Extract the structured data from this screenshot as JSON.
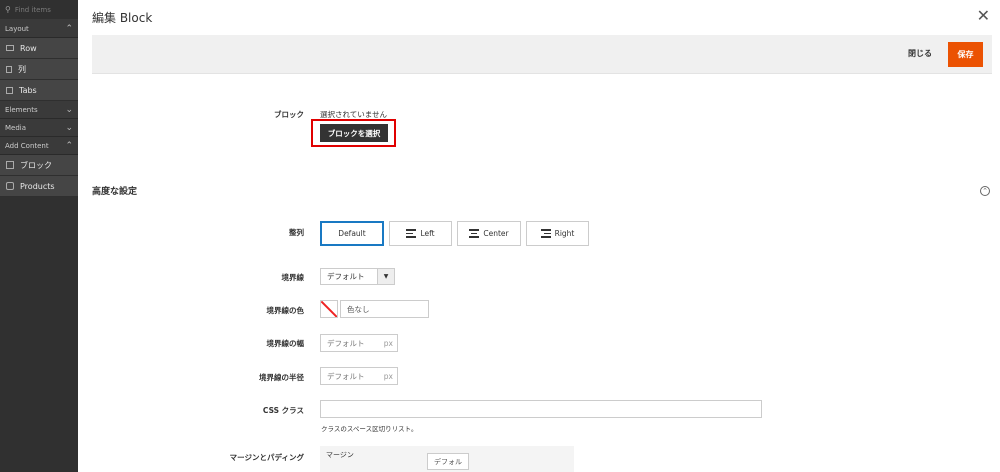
{
  "sidebar": {
    "search_placeholder": "Find items",
    "sections": {
      "layout": "Layout",
      "elements": "Elements",
      "media": "Media",
      "add_content": "Add Content"
    },
    "layout_items": [
      {
        "label": "Row",
        "icon": "row-icon"
      },
      {
        "label": "列",
        "icon": "column-icon"
      },
      {
        "label": "Tabs",
        "icon": "tabs-icon"
      }
    ],
    "add_content_items": [
      {
        "label": "ブロック",
        "icon": "block-icon"
      },
      {
        "label": "Products",
        "icon": "products-icon"
      }
    ]
  },
  "header": {
    "title": "編集 Block",
    "close_label": "閉じる",
    "save_label": "保存"
  },
  "block": {
    "label": "ブロック",
    "value": "選択されていません",
    "select_button": "ブロックを選択"
  },
  "advanced": {
    "title": "高度な設定",
    "alignment_label": "整列",
    "alignment_options": [
      "Default",
      "Left",
      "Center",
      "Right"
    ],
    "border_label": "境界線",
    "border_value": "デフォルト",
    "border_color_label": "境界線の色",
    "border_color_placeholder": "色なし",
    "border_width_label": "境界線の幅",
    "border_width_placeholder": "デフォルト",
    "border_width_unit": "px",
    "border_radius_label": "境界線の半径",
    "border_radius_placeholder": "デフォルト",
    "border_radius_unit": "px",
    "css_label": "CSS クラス",
    "css_hint": "クラスのスペース区切りリスト。",
    "margin_padding_label": "マージンとパディング",
    "margin_label": "マージン",
    "margin_value": "デフォル"
  },
  "colors": {
    "accent": "#eb5202",
    "sidebar_bg": "#303030",
    "highlight": "#e00000",
    "selected_border": "#1979c3"
  }
}
